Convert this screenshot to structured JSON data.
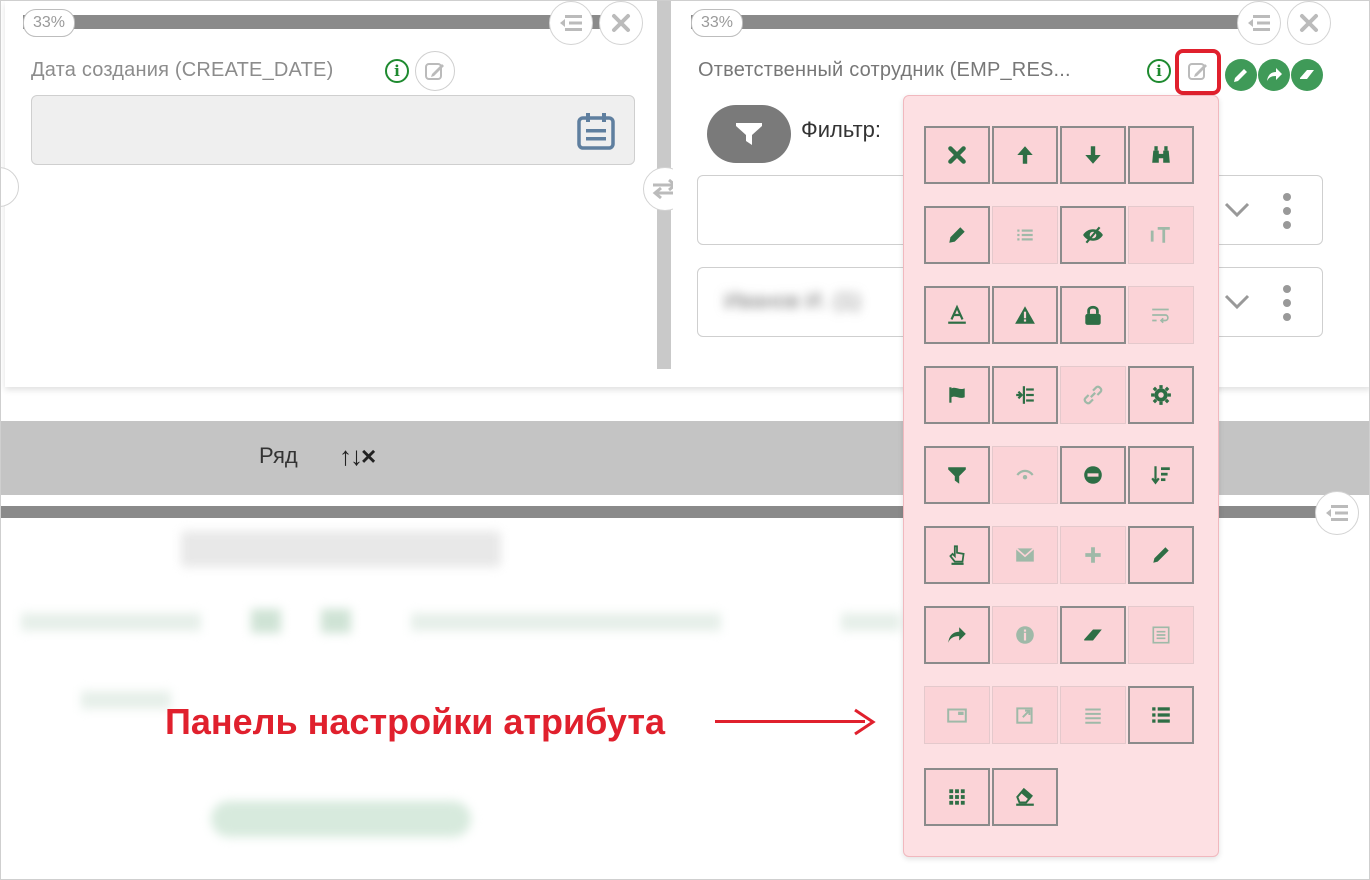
{
  "left_column": {
    "width_pct": "33%",
    "field_label": "Дата создания (CREATE_DATE)",
    "info_glyph": "i"
  },
  "right_column": {
    "width_pct": "33%",
    "field_label": "Ответственный сотрудник (EMP_RES...",
    "info_glyph": "i",
    "filter_label": "Фильтр:",
    "blurred_value": "Иванов И. (1)"
  },
  "row_bar": {
    "label": "Ряд",
    "controls": "↑↓×"
  },
  "callout": {
    "text": "Панель настройки атрибута",
    "color": "#e0202d"
  },
  "colors": {
    "accent_green": "#3f9a58",
    "panel_bg": "#fde0e3",
    "highlight": "#e0202d"
  },
  "attribute_panel": {
    "rows": [
      [
        "delete-icon",
        "move-up-icon",
        "move-down-icon",
        "binoculars-icon"
      ],
      [
        "pencil-icon",
        "list-icon",
        "hidden-eye-icon",
        "text-size-icon"
      ],
      [
        "font-color-icon",
        "warning-icon",
        "lock-icon",
        "wrap-text-icon"
      ],
      [
        "flag-icon",
        "indent-icon",
        "link-icon",
        "gear-icon"
      ],
      [
        "filter-icon",
        "wifi-eye-icon",
        "minus-circle-icon",
        "sort-icon"
      ],
      [
        "pointer-icon",
        "envelope-icon",
        "plus-icon",
        "pencil-alt-icon"
      ],
      [
        "share-icon",
        "info-circle-icon",
        "eraser-icon",
        "form-icon"
      ],
      [
        "card-icon",
        "external-link-icon",
        "list-lines-icon",
        "list-bullets-icon"
      ],
      [
        "grid-icon",
        "clear-icon"
      ]
    ],
    "active": [
      [
        true,
        true,
        true,
        true
      ],
      [
        true,
        false,
        true,
        false
      ],
      [
        true,
        true,
        true,
        false
      ],
      [
        true,
        true,
        false,
        true
      ],
      [
        true,
        false,
        true,
        true
      ],
      [
        true,
        false,
        false,
        true
      ],
      [
        true,
        false,
        true,
        false
      ],
      [
        false,
        false,
        false,
        true
      ],
      [
        true,
        true
      ]
    ]
  }
}
